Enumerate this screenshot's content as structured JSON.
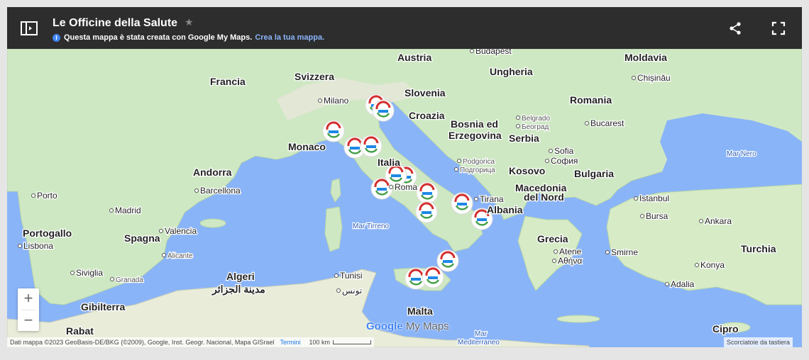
{
  "header": {
    "title": "Le Officine della Salute",
    "subtitle": "Questa mappa è stata creata con Google My Maps.",
    "create_link": "Crea la tua mappa.",
    "star_icon": "star-icon",
    "share_icon": "share-icon",
    "fullscreen_icon": "fullscreen-icon",
    "panel_icon": "side-panel-icon"
  },
  "zoom": {
    "plus": "+",
    "minus": "−"
  },
  "colors": {
    "water": "#8ab4f8",
    "land": "#c8e6c9",
    "header": "#2d2d2d",
    "accent": "#8ab4f8"
  },
  "labels": {
    "countries": [
      "Austria",
      "Ungheria",
      "Moldavia",
      "Francia",
      "Svizzera",
      "Slovenia",
      "Romania",
      "Croazia",
      "Bosnia ed",
      "Erzegovina",
      "Serbia",
      "Monaco",
      "Italia",
      "Kosovo",
      "Bulgaria",
      "Andorra",
      "Macedonia",
      "del Nord",
      "Albania",
      "Portogallo",
      "Spagna",
      "Grecia",
      "Turchia",
      "Malta",
      "Cipro",
      "Gibilterra",
      "Rabat",
      "Tunisi",
      "تونس",
      "Algeri",
      "مدينة الجزائر"
    ],
    "cities": [
      "Budapest",
      "Chișinău",
      "Milano",
      "Belgrado",
      "Београд",
      "Bucarest",
      "Sofia",
      "София",
      "Podgorica",
      "Подгорица",
      "Tirana",
      "Istanbul",
      "Bursa",
      "Ankara",
      "Porto",
      "Madrid",
      "Barcellona",
      "Lisbona",
      "Valencia",
      "Alicante",
      "Siviglia",
      "Granada",
      "Smirne",
      "Atene",
      "Αθήνα",
      "Konya",
      "Adalia",
      "Roma"
    ],
    "seas": [
      "Mar Nero",
      "Mar Tirreno",
      "Mar",
      "Mediterraneo"
    ]
  },
  "markers_count": 15,
  "attribution": {
    "data": "Dati mappa ©2023 GeoBasis-DE/BKG (©2009), Google, Inst. Geogr. Nacional, Mapa GISrael",
    "terms": "Termini",
    "scale": "100 km",
    "shortcuts": "Scorciatoie da tastiera"
  },
  "logo": {
    "google": "Google",
    "mymaps": "My Maps"
  }
}
